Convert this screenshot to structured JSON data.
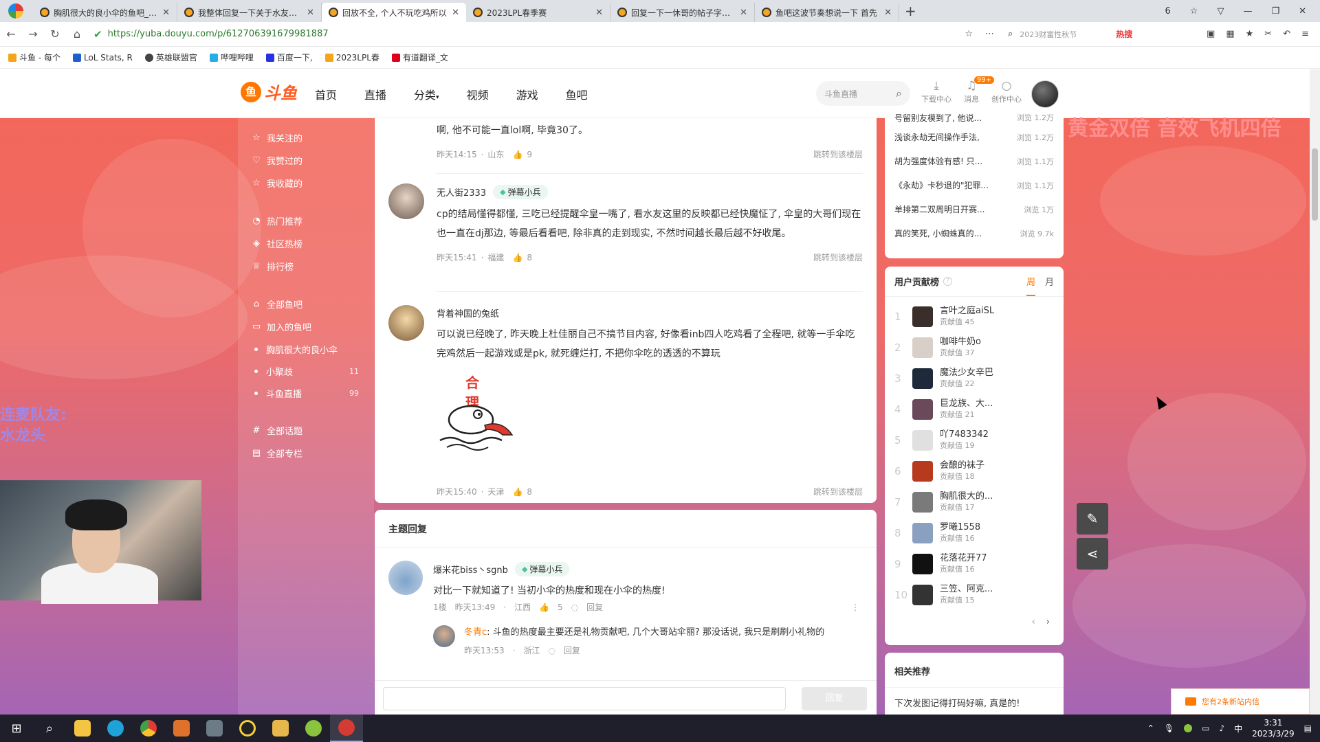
{
  "browser": {
    "tabs": [
      {
        "title": "胸肌很大的良小伞的鱼吧_斗鱼",
        "active": false
      },
      {
        "title": "我整体回复一下关于水友们不",
        "active": false
      },
      {
        "title": "回放不全, 个人不玩吃鸡所以",
        "active": true
      },
      {
        "title": "2023LPL春季赛",
        "active": false
      },
      {
        "title": "回复一下一休哥的帖子字数太",
        "active": false
      },
      {
        "title": "鱼吧这波节奏想说一下 首先",
        "active": false
      }
    ],
    "tab_count": "6",
    "url": "https://yuba.douyu.com/p/612706391679981887",
    "search_placeholder": "2023财富性秋节",
    "hot_label": "热搜",
    "bookmarks": [
      "斗鱼 - 每个",
      "LoL Stats, R",
      "英雄联盟官",
      "哔哩哔哩",
      "百度一下,",
      "2023LPL春",
      "有道翻译_文"
    ]
  },
  "site": {
    "logo_text": "斗鱼",
    "nav": [
      "首页",
      "直播",
      "分类",
      "视频",
      "游戏",
      "鱼吧"
    ],
    "search_placeholder": "斗鱼直播",
    "download_label": "下载中心",
    "message_label": "消息",
    "message_badge": "99+",
    "creator_label": "创作中心"
  },
  "overlay": {
    "left_line1": "连麦队友:",
    "left_line2": "水龙头",
    "right_banner": "黄金双倍 音效飞机四倍"
  },
  "sidebar": {
    "group1": [
      "我关注的",
      "我赞过的",
      "我收藏的"
    ],
    "group2": [
      "热门推荐",
      "社区热榜",
      "排行榜"
    ],
    "group3": [
      "全部鱼吧",
      "加入的鱼吧"
    ],
    "joined": [
      {
        "name": "胸肌很大的良小伞",
        "count": ""
      },
      {
        "name": "小聚歧",
        "count": "11"
      },
      {
        "name": "斗鱼直播",
        "count": "99"
      }
    ],
    "group4": [
      "全部话题",
      "全部专栏"
    ]
  },
  "posts": [
    {
      "name": "",
      "text": "啊, 他不可能一直lol啊, 毕竟30了。",
      "time": "昨天14:15",
      "location": "山东",
      "likes": "9",
      "jump": "跳转到该楼层"
    },
    {
      "name": "无人街2333",
      "badge": "弹幕小兵",
      "text": "cp的结局懂得都懂, 三吃已经提醒伞皇一嘴了, 看水友这里的反映都已经快魔怔了, 伞皇的大哥们现在也一直在dj那边, 等最后看看吧, 除非真的走到现实, 不然时间越长最后越不好收尾。",
      "time": "昨天15:41",
      "location": "福建",
      "likes": "8",
      "jump": "跳转到该楼层"
    },
    {
      "name": "背着神国的兔纸",
      "text": "可以说已经晚了, 昨天晚上杜佳丽自己不搞节目内容, 好像看inb四人吃鸡看了全程吧, 就等一手伞吃完鸡然后一起游戏或是pk, 就死缠烂打, 不把你伞吃的透透的不算玩",
      "sticker_text": "合 理",
      "time": "昨天15:40",
      "location": "天津",
      "likes": "8",
      "jump": "跳转到该楼层"
    }
  ],
  "replies": {
    "title": "主题回复",
    "main": {
      "name": "爆米花biss丶sgnb",
      "badge": "弹幕小兵",
      "text": "对比一下就知道了! 当初小伞的热度和现在小伞的热度!",
      "floor": "1楼",
      "time": "昨天13:49",
      "location": "江西",
      "likes": "5",
      "reply_label": "回复"
    },
    "sub": {
      "name": "冬青c",
      "text": "斗鱼的热度最主要还是礼物贡献吧, 几个大哥站伞丽? 那没话说, 我只是刷刷小礼物的",
      "time": "昨天13:53",
      "location": "浙江",
      "reply_label": "回复"
    },
    "reply_button": "回复"
  },
  "hot_list": [
    {
      "title": "号留别友模到了, 他说...",
      "views": "浏览 1.2万"
    },
    {
      "title": "浅谈永劫无间操作手法,",
      "views": "浏览 1.2万"
    },
    {
      "title": "胡为强度体验有感! 只...",
      "views": "浏览 1.1万"
    },
    {
      "title": "《永劫》卡秒退的\"犯罪...",
      "views": "浏览 1.1万"
    },
    {
      "title": "单排第二双周明日开赛...",
      "views": "浏览 1万"
    },
    {
      "title": "真的笑死, 小蜘蛛真的...",
      "views": "浏览 9.7k"
    }
  ],
  "contrib": {
    "title": "用户贡献榜",
    "period_week": "周",
    "period_month": "月",
    "value_label": "贡献值",
    "rows": [
      {
        "rank": "1",
        "name": "言叶之庭aiSL",
        "value": "45"
      },
      {
        "rank": "2",
        "name": "咖啡牛奶o",
        "value": "37"
      },
      {
        "rank": "3",
        "name": "魔法少女辛巴",
        "value": "22"
      },
      {
        "rank": "4",
        "name": "巨龙族、大...",
        "value": "21"
      },
      {
        "rank": "5",
        "name": "吖7483342",
        "value": "19"
      },
      {
        "rank": "6",
        "name": "会酿的袜子",
        "value": "18"
      },
      {
        "rank": "7",
        "name": "胸肌很大的...",
        "value": "17"
      },
      {
        "rank": "8",
        "name": "罗曦1558",
        "value": "16"
      },
      {
        "rank": "9",
        "name": "花落花开77",
        "value": "16"
      },
      {
        "rank": "10",
        "name": "三笠、阿克...",
        "value": "15"
      }
    ]
  },
  "related": {
    "title": "相关推荐",
    "item": "下次发图记得打码好嘛, 真是的!"
  },
  "notice": "您有2条新站内信",
  "taskbar": {
    "time": "3:31",
    "date": "2023/3/29",
    "ime": "中"
  }
}
